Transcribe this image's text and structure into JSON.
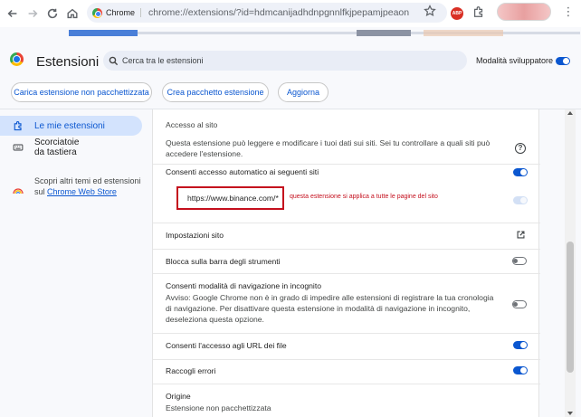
{
  "browser": {
    "chip_label": "Chrome",
    "url": "chrome://extensions/?id=hdmcanijadhdnpgnnlfkjpepamjpeaon",
    "ext_badge": "ABP"
  },
  "header": {
    "title": "Estensioni",
    "search_placeholder": "Cerca tra le estensioni",
    "dev_mode_label": "Modalità sviluppatore",
    "dev_mode_on": true,
    "buttons": {
      "load_unpacked": "Carica estensione non pacchettizzata",
      "pack": "Crea pacchetto estensione",
      "update": "Aggiorna"
    }
  },
  "sidebar": {
    "items": [
      {
        "label": "Le mie estensioni",
        "icon": "puzzle-icon",
        "active": true
      },
      {
        "label": "Scorciatoie da tastiera",
        "icon": "keyboard-icon",
        "active": false
      }
    ],
    "promo_text": "Scopri altri temi ed estensioni sul ",
    "promo_link": "Chrome Web Store"
  },
  "details": {
    "site_access_heading": "Accesso al sito",
    "site_access_desc": "Questa estensione può leggere e modificare i tuoi dati sui siti. Sei tu controllare a quali siti può accedere l'estensione.",
    "auto_access_label": "Consenti accesso automatico ai seguenti siti",
    "site_url": "https://www.binance.com/*",
    "annotation": "questa estensione si applica a tutte le pagine del sito",
    "site_settings_label": "Impostazioni sito",
    "pin_label": "Blocca sulla barra degli strumenti",
    "incognito_label": "Consenti modalità di navigazione in incognito",
    "incognito_warning": "Avviso: Google Chrome non è in grado di impedire alle estensioni di registrare la tua cronologia di navigazione. Per disattivare questa estensione in modalità di navigazione in incognito, deseleziona questa opzione.",
    "file_urls_label": "Consenti l'accesso agli URL dei file",
    "errors_label": "Raccogli errori",
    "origin_heading": "Origine",
    "origin_value": "Estensione non pacchettizzata"
  },
  "colors": {
    "accent": "#0b57d0",
    "annotation_red": "#c40f1d",
    "active_nav_bg": "#d3e3fd"
  }
}
